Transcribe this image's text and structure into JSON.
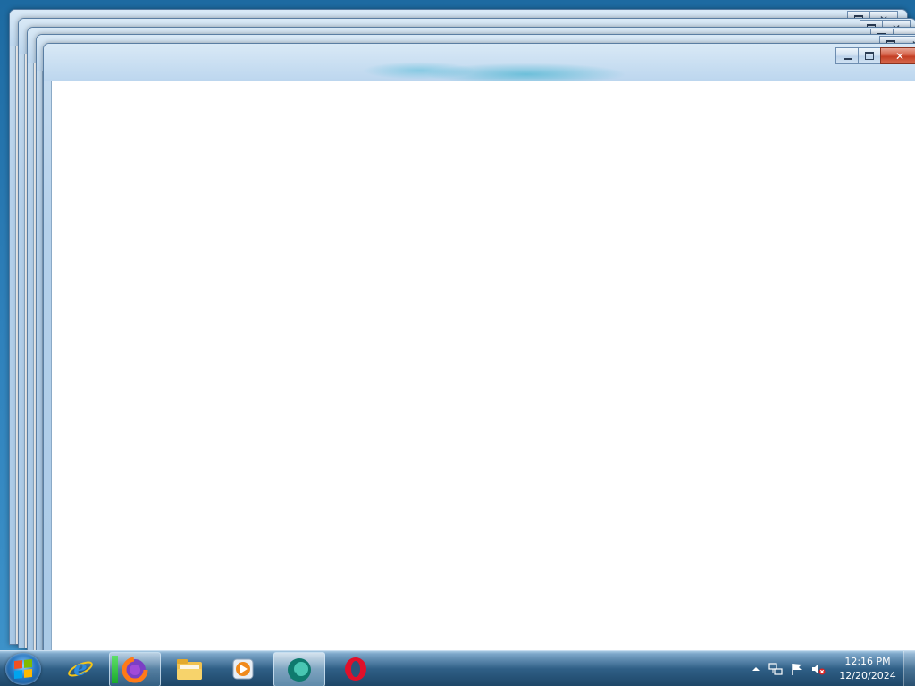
{
  "desktop": {
    "windows_stack_count": 5
  },
  "window_controls": {
    "minimize": "minimize-icon",
    "maximize": "maximize-icon",
    "close": "close-icon"
  },
  "taskbar": {
    "start_button": "windows-start-icon",
    "pinned": [
      {
        "name": "internet-explorer-icon",
        "running": false
      },
      {
        "name": "firefox-icon",
        "running": true
      },
      {
        "name": "file-explorer-icon",
        "running": false
      },
      {
        "name": "media-player-icon",
        "running": false
      },
      {
        "name": "app-green-icon",
        "running": true,
        "active": true
      },
      {
        "name": "opera-icon",
        "running": false
      }
    ],
    "tray": {
      "show_hidden": "chevron-up-icon",
      "network": "network-icon",
      "action_center": "flag-icon",
      "volume": "volume-muted-icon"
    },
    "clock": {
      "time": "12:16 PM",
      "date": "12/20/2024"
    }
  },
  "colors": {
    "taskbar_top": "#a6c8e2",
    "taskbar_bottom": "#1d4566",
    "window_frame": "#bcd6ee",
    "close_button": "#c23b21"
  }
}
